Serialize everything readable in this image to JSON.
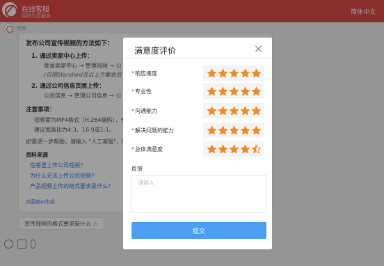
{
  "header": {
    "title": "在线客服",
    "subtitle": "始终为您服务",
    "language": "简体中文"
  },
  "chat": {
    "bot_name": "阿里",
    "title": "发布公司宣传视频的方法如下：",
    "step1": "1. 通过卖家中心上传：",
    "step1_item": "登录卖家中心 → 管理视频 → 公",
    "step1_note": "(仅限Standard及以上方案会员",
    "step2": "2. 通过公司信息页面上传：",
    "step2_item": "公司信息 → 管理公司信息 → 公",
    "notes_title": "注意事项：",
    "note1": "视频需为MP4格式（H.264编码），分",
    "note2": "建议宽高比为4:3、16:9或1:1。",
    "help": "如需进一步帮助，请输入 \"人工客服\"，感",
    "sources_title": "资料来源",
    "links": [
      "在哪里上传公司视频?",
      "为什么无法上传公司视频?",
      "产品视频上传的格式要求是什么?"
    ],
    "footer": "内容由AI生成",
    "input_hint": "宣传视频的格式要求是什么 ☆"
  },
  "modal": {
    "title": "满意度评价",
    "ratings": [
      {
        "label": "响应速度",
        "rating": 5
      },
      {
        "label": "专业性",
        "rating": 5
      },
      {
        "label": "沟通能力",
        "rating": 5
      },
      {
        "label": "解决问题的能力",
        "rating": 5
      },
      {
        "label": "总体满意度",
        "rating": 4.5
      }
    ],
    "feedback_label": "反馈",
    "feedback_placeholder": "请输入",
    "submit_label": "提交"
  },
  "colors": {
    "header_red": "#dd4747",
    "star_orange": "#f08a24",
    "submit_blue": "#4a9ff5",
    "required_red": "#e33"
  }
}
